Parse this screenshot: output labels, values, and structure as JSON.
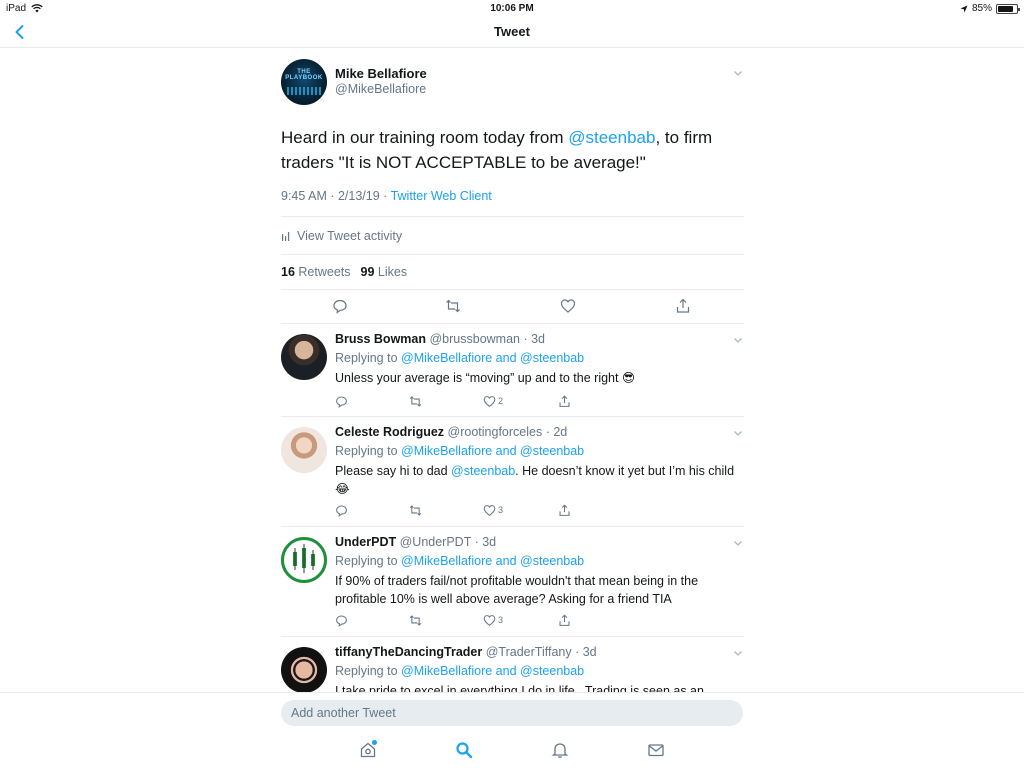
{
  "status_bar": {
    "device": "iPad",
    "time": "10:06 PM",
    "battery": "85%",
    "battery_level": 0.85
  },
  "nav": {
    "title": "Tweet",
    "back_icon": "chevron-left-icon"
  },
  "tweet": {
    "author_name": "Mike Bellafiore",
    "author_handle": "@MikeBellafiore",
    "avatar_text": "THE PLAYBOOK",
    "text_before": "Heard in our training room today from ",
    "mention": "@steenbab",
    "text_after": ", to firm traders \"It is NOT ACCEPTABLE to be average!\"",
    "timestamp": "9:45 AM · 2/13/19 · ",
    "source": "Twitter Web Client",
    "activity_label": "View Tweet activity",
    "retweet_count": "16",
    "retweet_label": "Retweets",
    "like_count": "99",
    "like_label": "Likes"
  },
  "replies": [
    {
      "name": "Bruss Bowman",
      "handle": "@brussbowman",
      "time": "3d",
      "replying_label": "Replying to ",
      "replying_to": "@MikeBellafiore and @steenbab",
      "text_before": "Unless your average is “moving” up and to the right 😎",
      "mention": "",
      "text_after": "",
      "reply_count": "",
      "retweet_count": "",
      "like_count": "2"
    },
    {
      "name": "Celeste Rodriguez",
      "handle": "@rootingforceles",
      "time": "2d",
      "replying_label": "Replying to ",
      "replying_to": "@MikeBellafiore and @steenbab",
      "text_before": "Please say hi to dad ",
      "mention": "@steenbab",
      "text_after": ". He doesn’t know it yet but I’m his child 😂",
      "reply_count": "",
      "retweet_count": "",
      "like_count": "3"
    },
    {
      "name": "UnderPDT",
      "handle": "@UnderPDT",
      "time": "3d",
      "replying_label": "Replying to ",
      "replying_to": "@MikeBellafiore and @steenbab",
      "text_before": "If 90% of traders fail/not profitable wouldn't that mean being in the profitable 10% is well above average? Asking for a friend TIA",
      "mention": "",
      "text_after": "",
      "reply_count": "",
      "retweet_count": "",
      "like_count": "3"
    },
    {
      "name": "tiffanyTheDancingTrader",
      "handle": "@TraderTiffany",
      "time": "3d",
      "replying_label": "Replying to ",
      "replying_to": "@MikeBellafiore and @steenbab",
      "text_before": "I take pride to excel in everything I do in life.. Trading is seen as an",
      "mention": "",
      "text_after": "",
      "reply_count": "",
      "retweet_count": "",
      "like_count": ""
    }
  ],
  "compose": {
    "placeholder": "Add another Tweet"
  },
  "tabs": [
    "home-icon",
    "search-icon",
    "notifications-icon",
    "messages-icon"
  ],
  "colors": {
    "accent": "#1da1f2",
    "text": "#14171a",
    "secondary": "#657786",
    "divider": "#e6ecf0"
  }
}
